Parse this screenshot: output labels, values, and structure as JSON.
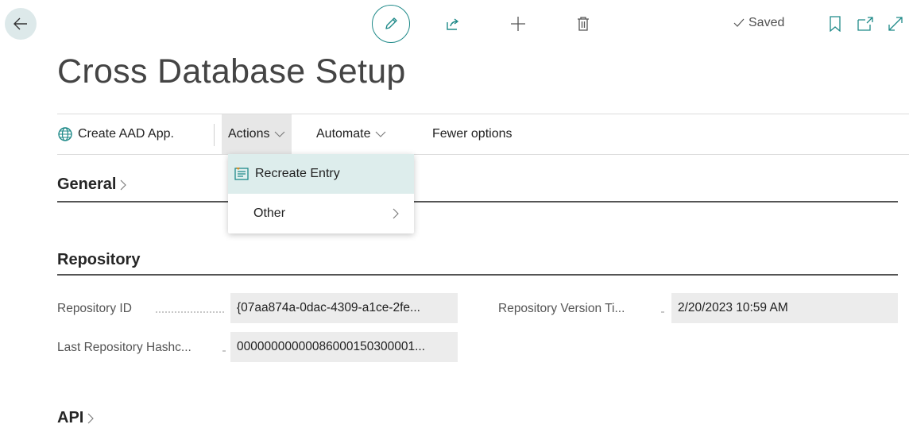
{
  "header": {
    "saved_label": "Saved",
    "page_title": "Cross Database Setup"
  },
  "action_bar": {
    "create_aad_app_label": "Create AAD App.",
    "actions_label": "Actions",
    "automate_label": "Automate",
    "fewer_options_label": "Fewer options"
  },
  "actions_menu": {
    "items": [
      {
        "label": "Recreate Entry",
        "icon": "recreate-entry-icon"
      },
      {
        "label": "Other",
        "icon": "chevron-right-icon"
      }
    ]
  },
  "sections": {
    "general_label": "General",
    "repository_label": "Repository",
    "api_label": "API"
  },
  "repository": {
    "repository_id_label": "Repository ID",
    "repository_id_value": "{07aa874a-0dac-4309-a1ce-2fe...",
    "last_hash_label": "Last Repository Hashc...",
    "last_hash_value": "00000000000086000150300001...",
    "version_time_label": "Repository Version Ti...",
    "version_time_value": "2/20/2023 10:59 AM"
  },
  "colors": {
    "accent": "#1f8a89",
    "menu_highlight": "#ddedec"
  }
}
